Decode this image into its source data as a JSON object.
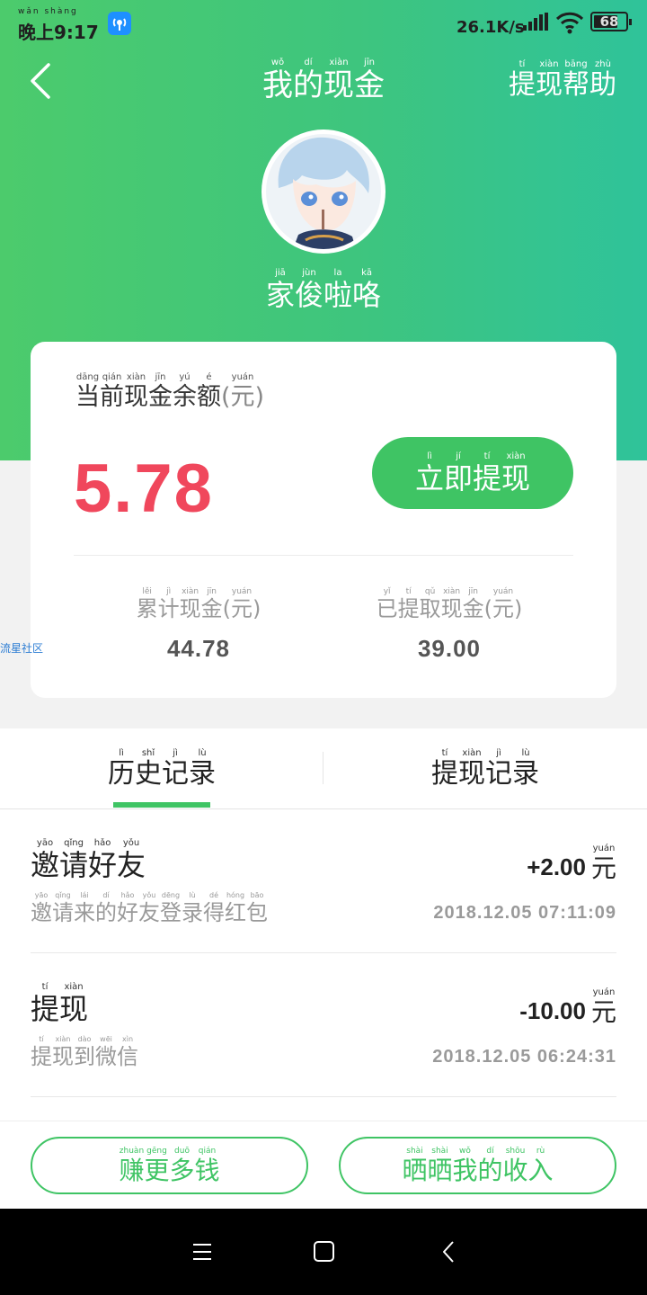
{
  "status_bar": {
    "time_pinyin": "wǎn shàng",
    "time": "晚上9:17",
    "net_speed": "26.1K/s",
    "battery": "68"
  },
  "header": {
    "title": [
      {
        "py": "wǒ",
        "hz": "我"
      },
      {
        "py": "dí",
        "hz": "的"
      },
      {
        "py": "xiàn",
        "hz": "现"
      },
      {
        "py": "jīn",
        "hz": "金"
      }
    ],
    "help": [
      {
        "py": "tí",
        "hz": "提"
      },
      {
        "py": "xiàn",
        "hz": "现"
      },
      {
        "py": "bāng",
        "hz": "帮"
      },
      {
        "py": "zhù",
        "hz": "助"
      }
    ],
    "username": [
      {
        "py": "jiā",
        "hz": "家"
      },
      {
        "py": "jùn",
        "hz": "俊"
      },
      {
        "py": "la",
        "hz": "啦"
      },
      {
        "py": "kā",
        "hz": "咯"
      }
    ]
  },
  "card": {
    "balance_label": [
      {
        "py": "dāng",
        "hz": "当"
      },
      {
        "py": "qián",
        "hz": "前"
      },
      {
        "py": "xiàn",
        "hz": "现"
      },
      {
        "py": "jīn",
        "hz": "金"
      },
      {
        "py": "yú",
        "hz": "余"
      },
      {
        "py": "é",
        "hz": "额"
      }
    ],
    "unit": [
      {
        "py": "",
        "hz": "("
      },
      {
        "py": "yuán",
        "hz": "元"
      },
      {
        "py": "",
        "hz": ")"
      }
    ],
    "balance": "5.78",
    "withdraw_button": [
      {
        "py": "lì",
        "hz": "立"
      },
      {
        "py": "jí",
        "hz": "即"
      },
      {
        "py": "tí",
        "hz": "提"
      },
      {
        "py": "xiàn",
        "hz": "现"
      }
    ],
    "total_label": [
      {
        "py": "lěi",
        "hz": "累"
      },
      {
        "py": "jì",
        "hz": "计"
      },
      {
        "py": "xiàn",
        "hz": "现"
      },
      {
        "py": "jīn",
        "hz": "金"
      },
      {
        "py": "",
        "hz": "("
      },
      {
        "py": "yuán",
        "hz": "元"
      },
      {
        "py": "",
        "hz": ")"
      }
    ],
    "total_value": "44.78",
    "withdrawn_label": [
      {
        "py": "yǐ",
        "hz": "已"
      },
      {
        "py": "tí",
        "hz": "提"
      },
      {
        "py": "qǔ",
        "hz": "取"
      },
      {
        "py": "xiàn",
        "hz": "现"
      },
      {
        "py": "jīn",
        "hz": "金"
      },
      {
        "py": "",
        "hz": "("
      },
      {
        "py": "yuán",
        "hz": "元"
      },
      {
        "py": "",
        "hz": ")"
      }
    ],
    "withdrawn_value": "39.00"
  },
  "watermark": "流星社区",
  "tabs": {
    "history": [
      {
        "py": "lì",
        "hz": "历"
      },
      {
        "py": "shǐ",
        "hz": "史"
      },
      {
        "py": "jì",
        "hz": "记"
      },
      {
        "py": "lù",
        "hz": "录"
      }
    ],
    "withdraw": [
      {
        "py": "tí",
        "hz": "提"
      },
      {
        "py": "xiàn",
        "hz": "现"
      },
      {
        "py": "jì",
        "hz": "记"
      },
      {
        "py": "lù",
        "hz": "录"
      }
    ]
  },
  "records": [
    {
      "title": [
        {
          "py": "yāo",
          "hz": "邀"
        },
        {
          "py": "qǐng",
          "hz": "请"
        },
        {
          "py": "hǎo",
          "hz": "好"
        },
        {
          "py": "yǒu",
          "hz": "友"
        }
      ],
      "desc": [
        {
          "py": "yāo",
          "hz": "邀"
        },
        {
          "py": "qǐng",
          "hz": "请"
        },
        {
          "py": "lái",
          "hz": "来"
        },
        {
          "py": "dí",
          "hz": "的"
        },
        {
          "py": "hǎo",
          "hz": "好"
        },
        {
          "py": "yǒu",
          "hz": "友"
        },
        {
          "py": "dēng",
          "hz": "登"
        },
        {
          "py": "lù",
          "hz": "录"
        },
        {
          "py": "dé",
          "hz": "得"
        },
        {
          "py": "hóng",
          "hz": "红"
        },
        {
          "py": "bāo",
          "hz": "包"
        }
      ],
      "amount": "+2.00",
      "unit": [
        {
          "py": "yuán",
          "hz": "元"
        }
      ],
      "time": "2018.12.05 07:11:09"
    },
    {
      "title": [
        {
          "py": "tí",
          "hz": "提"
        },
        {
          "py": "xiàn",
          "hz": "现"
        }
      ],
      "desc": [
        {
          "py": "tí",
          "hz": "提"
        },
        {
          "py": "xiàn",
          "hz": "现"
        },
        {
          "py": "dào",
          "hz": "到"
        },
        {
          "py": "wēi",
          "hz": "微"
        },
        {
          "py": "xìn",
          "hz": "信"
        }
      ],
      "amount": "-10.00",
      "unit": [
        {
          "py": "yuán",
          "hz": "元"
        }
      ],
      "time": "2018.12.05 06:24:31"
    }
  ],
  "bottom_buttons": {
    "earn": [
      {
        "py": "zhuàn",
        "hz": "赚"
      },
      {
        "py": "gēng",
        "hz": "更"
      },
      {
        "py": "duō",
        "hz": "多"
      },
      {
        "py": "qián",
        "hz": "钱"
      }
    ],
    "share": [
      {
        "py": "shài",
        "hz": "晒"
      },
      {
        "py": "shài",
        "hz": "晒"
      },
      {
        "py": "wǒ",
        "hz": "我"
      },
      {
        "py": "dí",
        "hz": "的"
      },
      {
        "py": "shōu",
        "hz": "收"
      },
      {
        "py": "rù",
        "hz": "入"
      }
    ]
  },
  "colors": {
    "header_start": "#4ccb6c",
    "header_end": "#2fc39a",
    "accent_green": "#3fc464",
    "balance_red": "#f0475c"
  },
  "icons": {
    "back": "chevron-left-icon",
    "nav_menu": "menu-icon",
    "nav_home": "home-square-icon",
    "nav_back": "back-triangle-icon"
  }
}
